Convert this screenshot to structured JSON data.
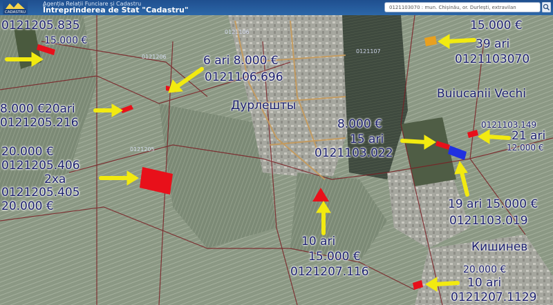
{
  "header": {
    "agency": "Agenția Relații Funciare și Cadastru",
    "state_enterprise": "Întreprinderea de Stat \"Cadastru\"",
    "logo_text": "CADASTRU",
    "search_value": "0121103070 : mun. Chișinău, or. Durlești, extravilan"
  },
  "places": {
    "durleshty": "Дурлешты",
    "buiucanii": "Buiucanii Vechi",
    "kishinev": "Кишинев"
  },
  "sector_codes": [
    "0121106",
    "0121107",
    "0121205",
    "0121206"
  ],
  "labels": {
    "p1_code": "0121205.835",
    "p1_price": "15.000 €",
    "p2_size_price": "6 ari 8.000 €",
    "p2_code": "0121106.696",
    "p3_price_size": "8.000 €20ari",
    "p3_code": "0121205.216",
    "p4_price_top": "20.000 €",
    "p4_code_a": "0121205.406",
    "p4_size": "2xa",
    "p4_code_b": "0121205.405",
    "p4_price_bottom": "20.000 €",
    "p5_price": "15.000 €",
    "p5_size": "39 ari",
    "p5_code": "0121103070",
    "p6_price": "8.000 €",
    "p6_size": "15 ari",
    "p6_code": "0121103.022",
    "p7_code": "0121103.149",
    "p7_size": "21 ari",
    "p7_price": "12.000 €",
    "p8_size_price": "19 ari 15.000 €",
    "p8_code": "0121103.019",
    "p9_size": "10 ari",
    "p9_price": "15.000 €",
    "p9_code": "0121207.116",
    "p10_price": "20.000 €",
    "p10_size": "10 ari",
    "p10_code": "0121207.1129"
  },
  "colors": {
    "parcel_red": "#e8101a",
    "parcel_blue": "#2030e0",
    "parcel_orange": "#e8a020",
    "arrow_yellow": "#f2ea10",
    "label_navy": "#1b1f6e",
    "road": "#c79a5a",
    "header_blue": "#2c67a8"
  }
}
